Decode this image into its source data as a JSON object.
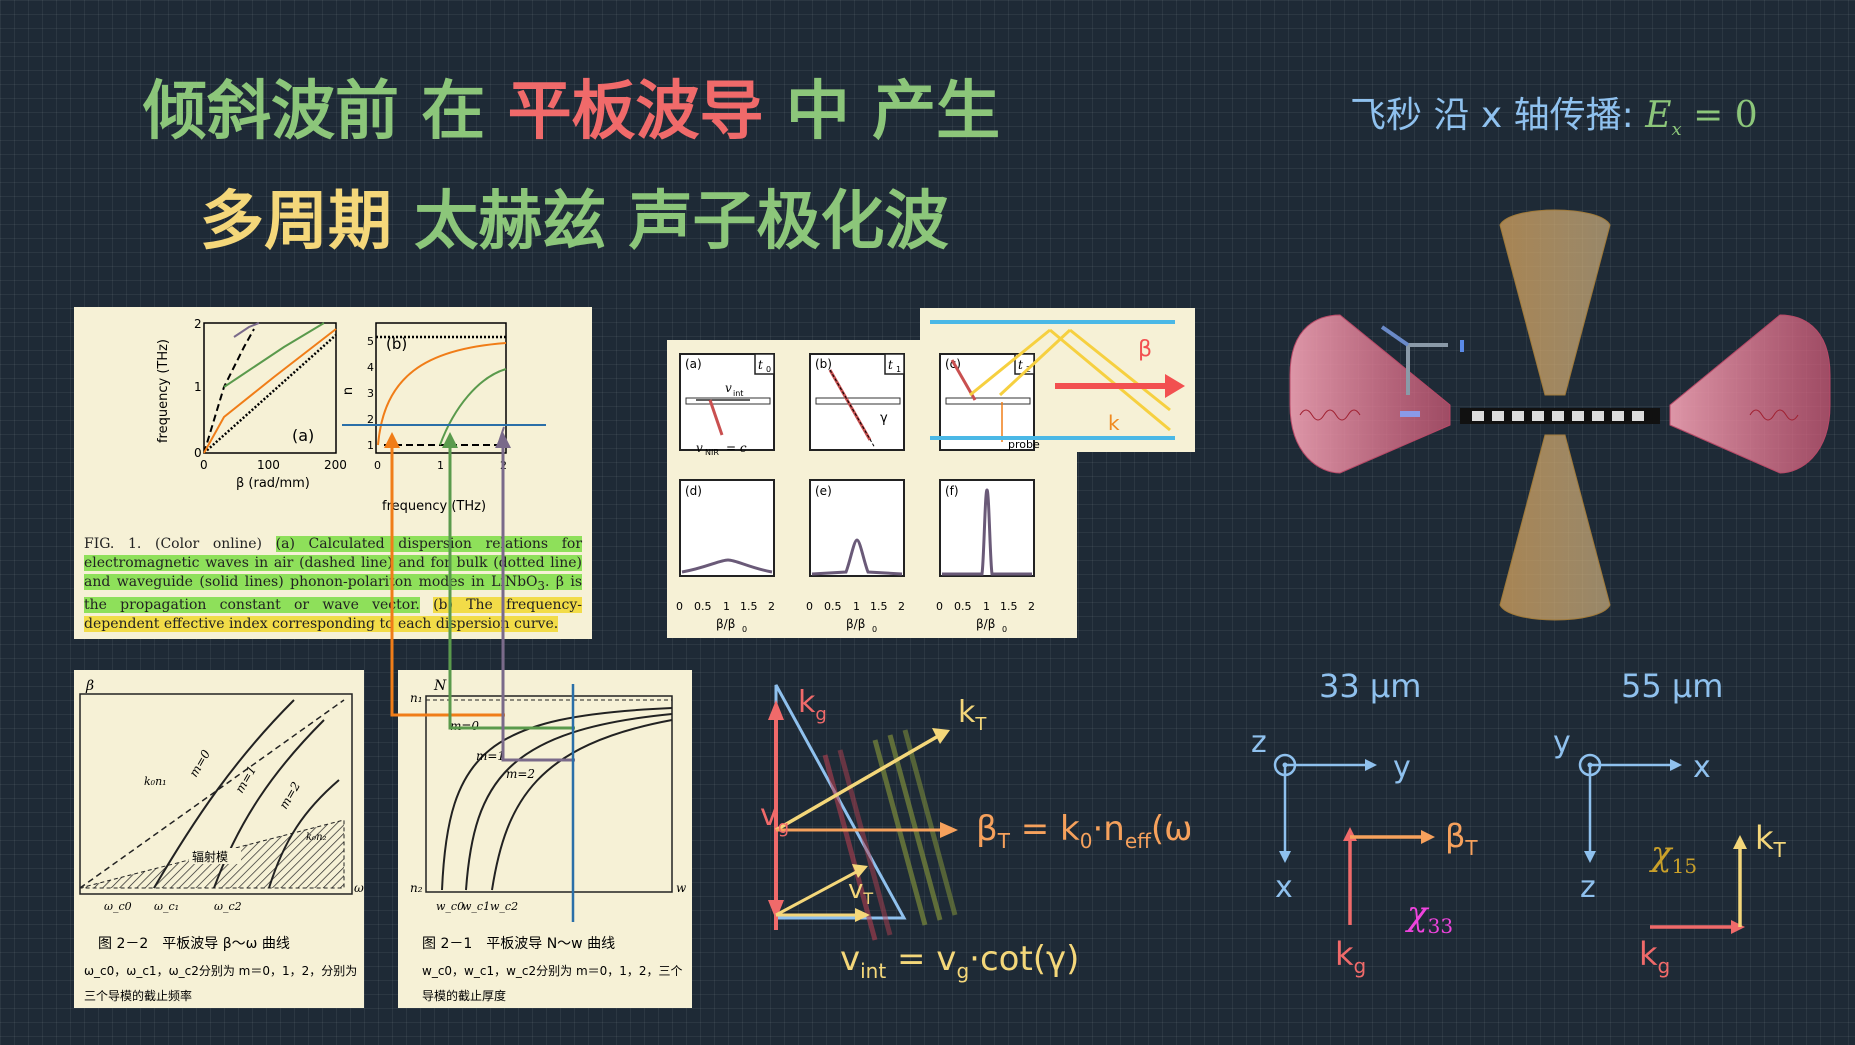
{
  "title": {
    "line1": [
      {
        "text": "倾斜波前",
        "color": "green"
      },
      {
        "text": "在",
        "color": "green"
      },
      {
        "text": "平板波导",
        "color": "red"
      },
      {
        "text": "中",
        "color": "green"
      },
      {
        "text": "产生",
        "color": "green"
      }
    ],
    "line2": [
      {
        "text": "多周期",
        "color": "yellow"
      },
      {
        "text": "太赫兹",
        "color": "green"
      },
      {
        "text": "声子极化波",
        "color": "green"
      }
    ]
  },
  "femto_label": {
    "prefix": "飞秒 沿 x 轴传播:",
    "math": "E",
    "sub": "x",
    "eq": "= 0"
  },
  "fig1": {
    "panel_a_label": "(a)",
    "panel_b_label": "(b)",
    "a_ylabel": "frequency (THz)",
    "a_xlabel": "β (rad/mm)",
    "a_yticks": [
      "0",
      "1",
      "2"
    ],
    "a_xticks": [
      "0",
      "100",
      "200"
    ],
    "b_ylabel": "n",
    "b_ylabel_sub": "eff",
    "b_xlabel": "frequency (THz)",
    "b_yticks": [
      "1",
      "2",
      "3",
      "4",
      "5"
    ],
    "b_xticks": [
      "0",
      "1",
      "2"
    ],
    "caption_plain": "FIG. 1. (Color online)",
    "caption_green": "(a) Calculated dispersion relations for electromagnetic waves in air (dashed line) and for bulk (dotted line) and waveguide (solid lines) phonon-polariton modes in LiNbO",
    "caption_green_sub": "3",
    "caption_green_tail": ". β is the propagation constant or wave vector.",
    "caption_yellow": "(b) The frequency-dependent effective index corresponding to each dispersion curve."
  },
  "fig2": {
    "panels_top": [
      {
        "label": "(a)",
        "time": "t",
        "time_sub": "0",
        "vint": "v",
        "vint_sub": "int",
        "vnir": "v",
        "vnir_sub": "NIR",
        "vnir_eq": "= c"
      },
      {
        "label": "(b)",
        "time": "t",
        "time_sub": "1",
        "gamma": "γ"
      },
      {
        "label": "(c)",
        "time": "t",
        "time_sub": "2",
        "probe": "probe"
      }
    ],
    "panels_bottom": [
      {
        "label": "(d)"
      },
      {
        "label": "(e)"
      },
      {
        "label": "(f)"
      }
    ],
    "xticks": [
      "0",
      "0.5",
      "1",
      "1.5",
      "2"
    ],
    "xlabel": "β/β",
    "xlabel_sub": "0",
    "beta": "β",
    "k": "k"
  },
  "book1": {
    "ylabel": "β",
    "xlabel": "ω",
    "line_label": "k₀n₁",
    "modes": [
      "m=0",
      "m=1",
      "m=2"
    ],
    "region": "辐射模",
    "region2": "k₀n₂",
    "xticks": [
      "ω_c0",
      "ω_c₁",
      "ω_c2"
    ],
    "caption": "图 2－2　平板波导 β～ω 曲线",
    "sub1": "ω_c0，ω_c1，ω_c2分别为 m＝0，1，2，分别为",
    "sub2": "三个导模的截止频率"
  },
  "book2": {
    "ylabel": "N",
    "xlabel": "w",
    "n1": "n₁",
    "n2": "n₂",
    "modes": [
      "m=0",
      "m=1",
      "m=2"
    ],
    "xticks": [
      "w_c0",
      "w_c1",
      "w_c2"
    ],
    "caption": "图 2－1　平板波导 N～w 曲线",
    "sub1": "w_c0，w_c1，w_c2分别为 m＝0，1，2，三个",
    "sub2": "导模的截止厚度"
  },
  "geometry": {
    "kg": "k",
    "kg_sub": "g",
    "kT": "k",
    "kT_sub": "T",
    "vg": "v",
    "vg_sub": "g",
    "vT": "v",
    "vT_sub": "T",
    "betaT_eq": "β",
    "betaT_sub": "T",
    "betaT_rhs": " = k",
    "betaT_rhs_sub": "0",
    "betaT_dot": "·n",
    "betaT_neff_sub": "eff",
    "betaT_omega": "(ω)",
    "vint_eq": "v",
    "vint_sub": "int",
    "vint_rhs": " = v",
    "vint_rhs_sub": "g",
    "vint_tail": "·cot(γ)"
  },
  "axes_33": {
    "size": "33 μm",
    "z": "z",
    "y": "y",
    "x": "x",
    "betaT": "β",
    "betaT_sub": "T",
    "kg": "k",
    "kg_sub": "g",
    "chi": "χ",
    "chi_sub": "33"
  },
  "axes_55": {
    "size": "55 μm",
    "y": "y",
    "x": "x",
    "z": "z",
    "kT": "k",
    "kT_sub": "T",
    "kg": "k",
    "kg_sub": "g",
    "chi": "χ",
    "chi_sub": "15"
  },
  "colors": {
    "green": "#8cc67a",
    "red": "#f06a6a",
    "yellow": "#f4d77a",
    "blue": "#8fc1ee",
    "orange": "#f6a15c",
    "pink": "#ee44dd",
    "gold": "#c9a02a"
  }
}
